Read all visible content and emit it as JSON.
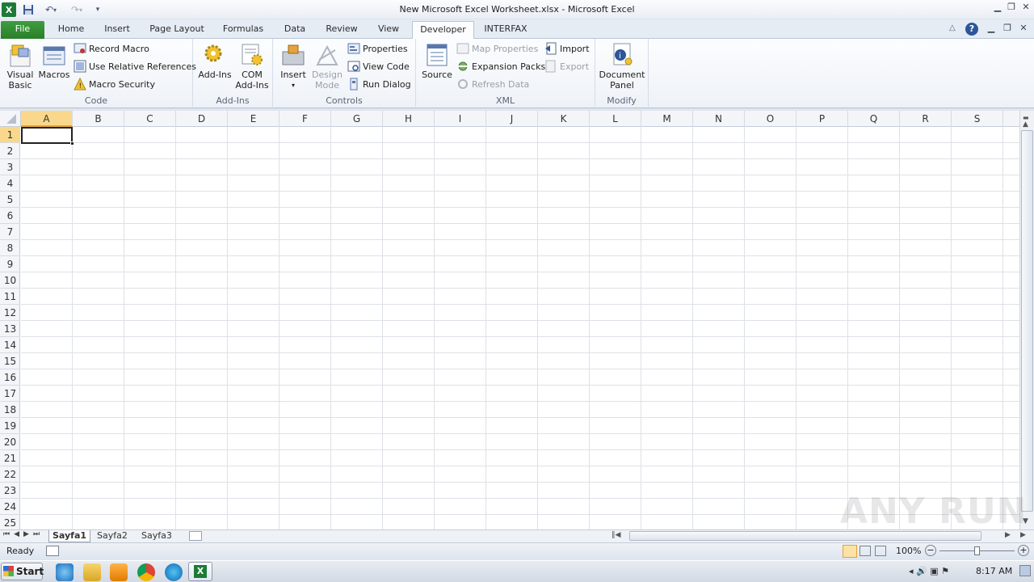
{
  "window": {
    "title": "New Microsoft Excel Worksheet.xlsx  -  Microsoft Excel"
  },
  "tabs": [
    "File",
    "Home",
    "Insert",
    "Page Layout",
    "Formulas",
    "Data",
    "Review",
    "View",
    "Developer",
    "INTERFAX"
  ],
  "ribbon": {
    "code": {
      "label": "Code",
      "visual_basic": "Visual\nBasic",
      "macros": "Macros",
      "record_macro": "Record Macro",
      "use_relative": "Use Relative References",
      "macro_security": "Macro Security"
    },
    "addins": {
      "label": "Add-Ins",
      "addins": "Add-Ins",
      "com_addins": "COM\nAdd-Ins"
    },
    "controls": {
      "label": "Controls",
      "insert": "Insert",
      "design_mode": "Design\nMode",
      "properties": "Properties",
      "view_code": "View Code",
      "run_dialog": "Run Dialog"
    },
    "xml": {
      "label": "XML",
      "source": "Source",
      "map_properties": "Map Properties",
      "expansion_packs": "Expansion Packs",
      "refresh_data": "Refresh Data",
      "import": "Import",
      "export": "Export"
    },
    "modify": {
      "label": "Modify",
      "document_panel": "Document\nPanel"
    }
  },
  "columns": [
    "A",
    "B",
    "C",
    "D",
    "E",
    "F",
    "G",
    "H",
    "I",
    "J",
    "K",
    "L",
    "M",
    "N",
    "O",
    "P",
    "Q",
    "R",
    "S"
  ],
  "rows": [
    "1",
    "2",
    "3",
    "4",
    "5",
    "6",
    "7",
    "8",
    "9",
    "10",
    "11",
    "12",
    "13",
    "14",
    "15",
    "16",
    "17",
    "18",
    "19",
    "20",
    "21",
    "22",
    "23",
    "24",
    "25"
  ],
  "sheets": [
    "Sayfa1",
    "Sayfa2",
    "Sayfa3"
  ],
  "active_sheet": "Sayfa1",
  "active_cell": "A1",
  "status": {
    "ready": "Ready",
    "zoom": "100%"
  },
  "taskbar": {
    "start": "Start",
    "clock": "8:17 AM"
  },
  "watermark": "ANY RUN",
  "colors": {
    "file_tab": "#2a7f2a",
    "accent": "#2b579a"
  }
}
